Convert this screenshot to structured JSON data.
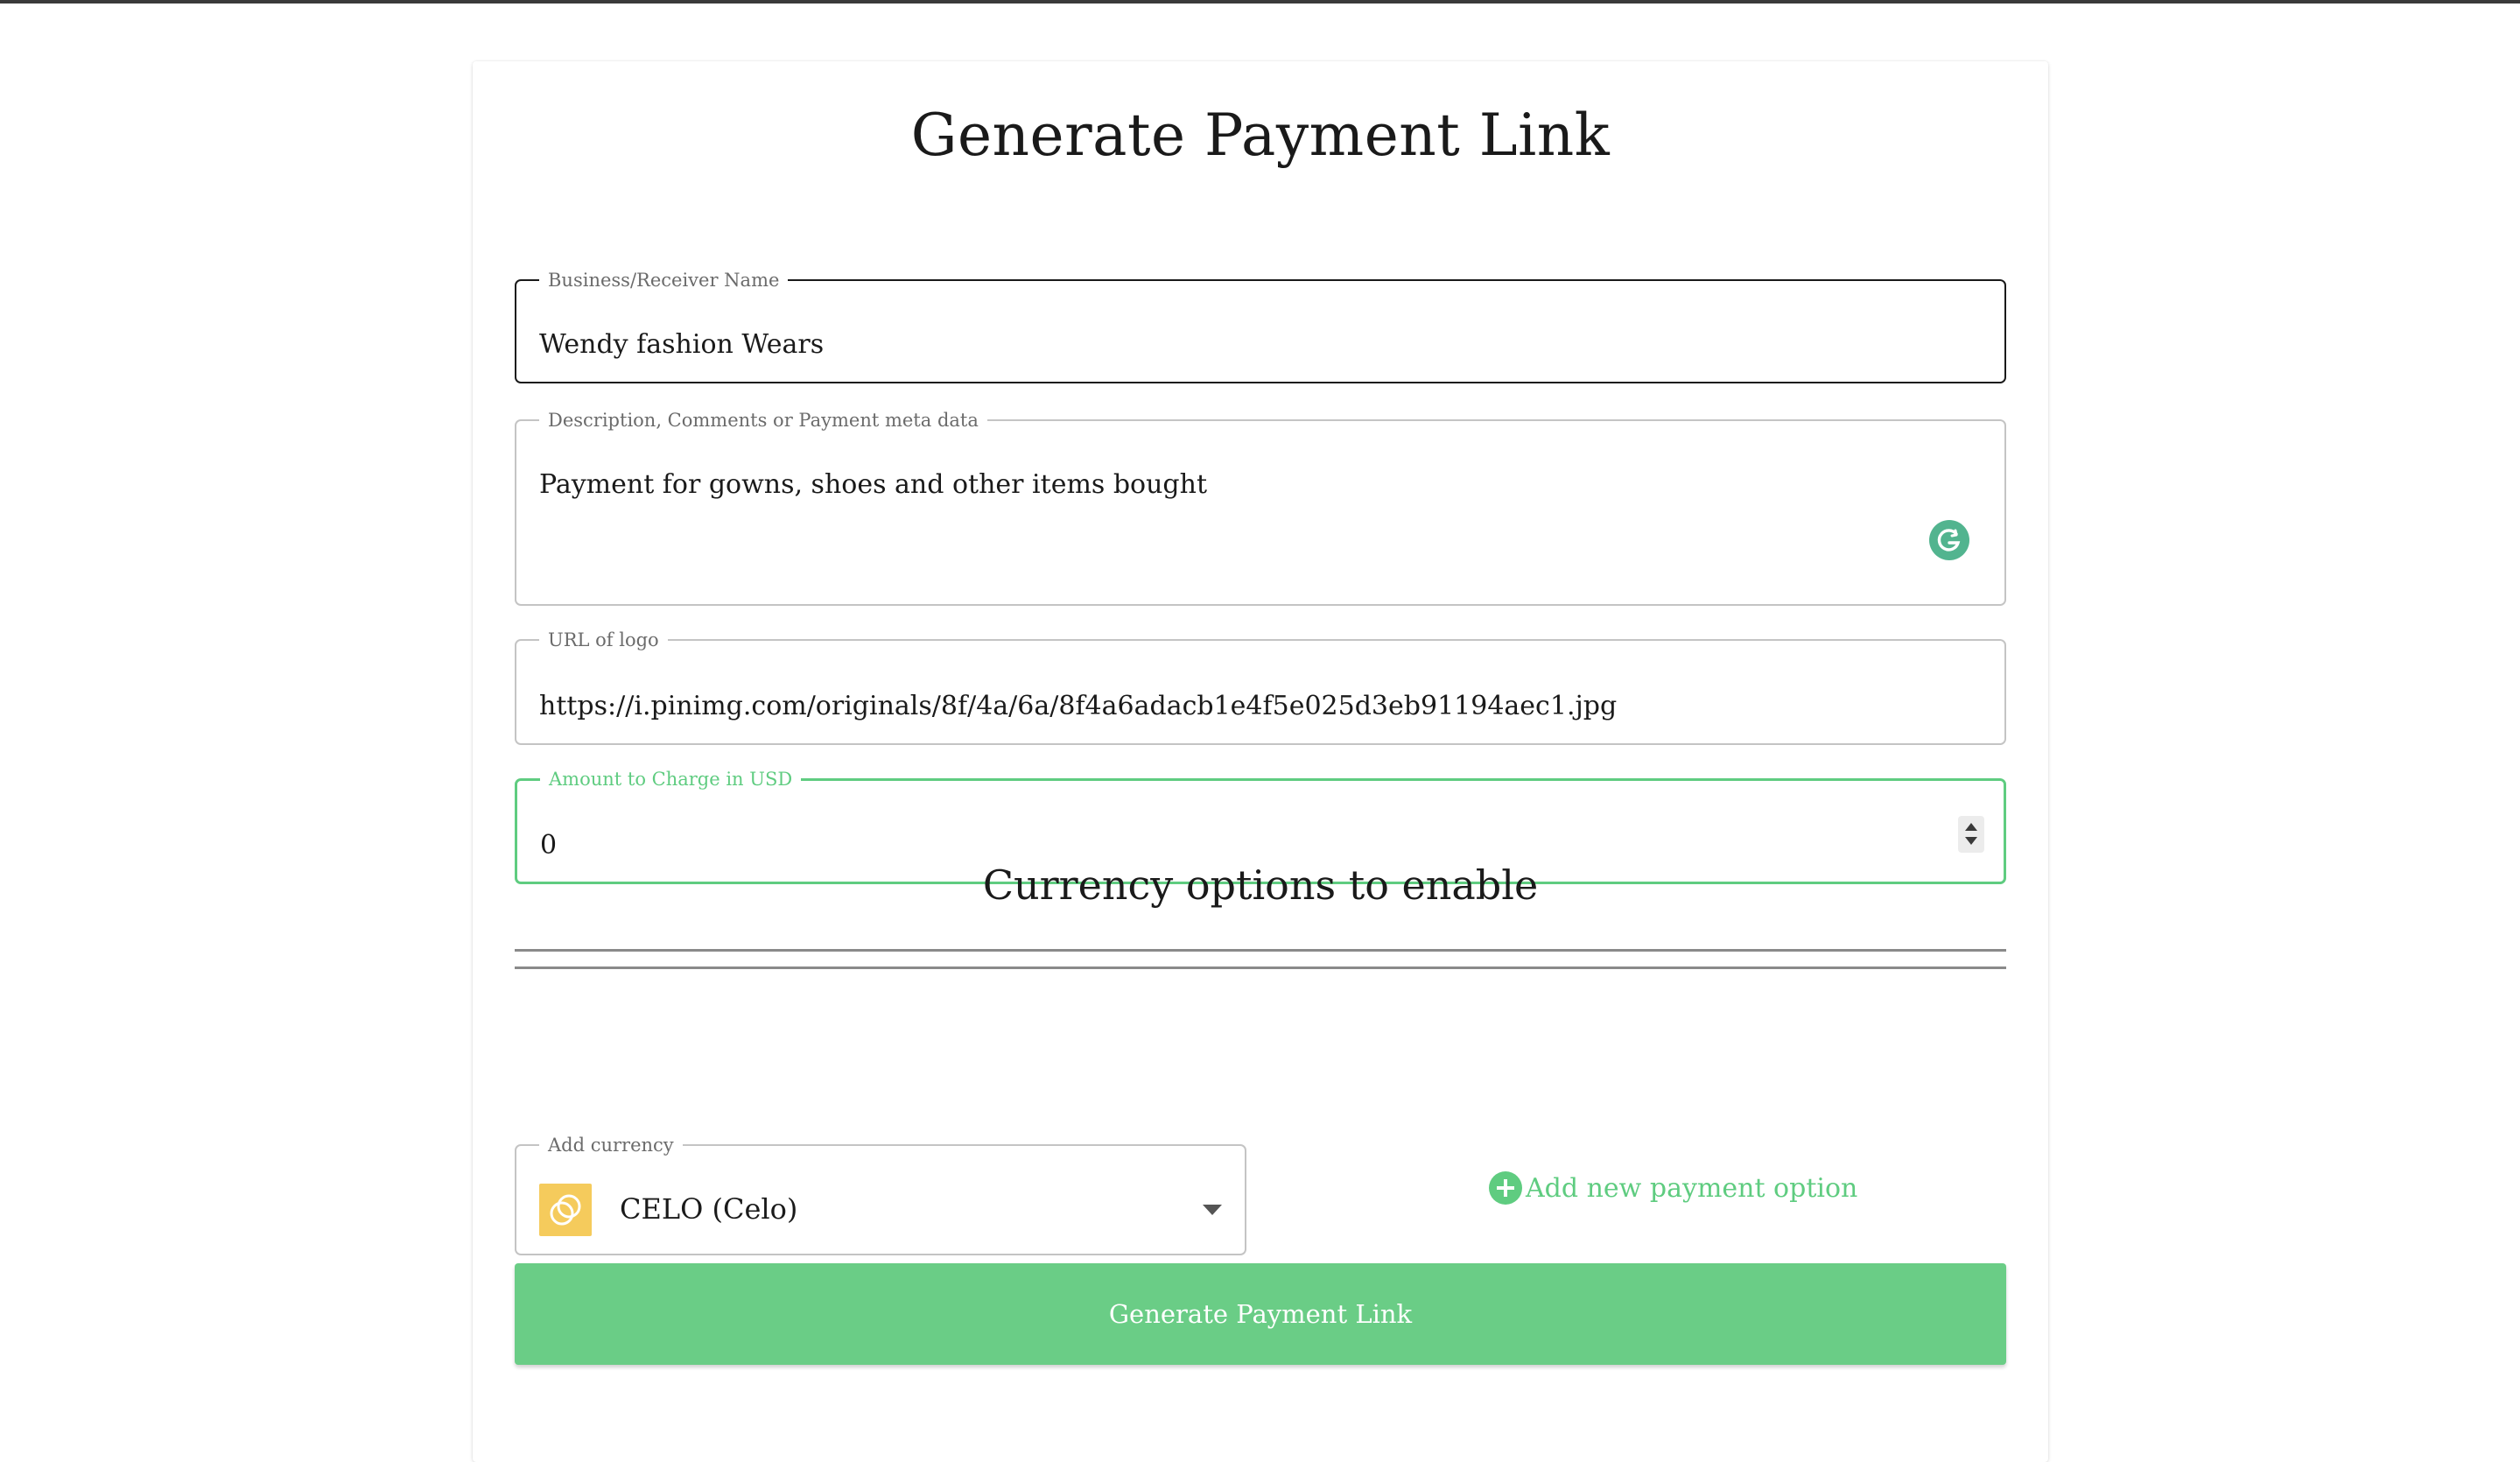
{
  "page": {
    "title": "Generate Payment Link"
  },
  "form": {
    "business": {
      "label": "Business/Receiver Name",
      "value": "Wendy fashion Wears"
    },
    "description": {
      "label": "Description, Comments or Payment meta data",
      "value": "Payment for gowns, shoes and other items bought"
    },
    "logo": {
      "label": "URL of logo",
      "value": "https://i.pinimg.com/originals/8f/4a/6a/8f4a6adacb1e4f5e025d3eb91194aec1.jpg"
    },
    "amount": {
      "label": "Amount to Charge in USD",
      "value": "0"
    }
  },
  "currency_section": {
    "title": "Currency options to enable",
    "add_currency": {
      "label": "Add currency",
      "value": "CELO (Celo)",
      "icon": "celo-logo-icon"
    },
    "add_option_label": "Add new payment option"
  },
  "submit": {
    "label": "Generate Payment Link"
  },
  "colors": {
    "accent": "#5fcc80",
    "button": "#6acd86",
    "celo_badge": "#f5cb5c",
    "grammarly": "#52b48f"
  }
}
